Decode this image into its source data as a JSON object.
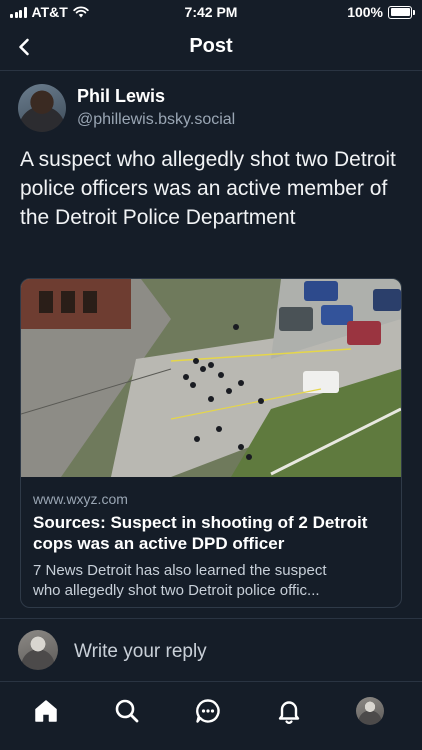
{
  "status_bar": {
    "carrier": "AT&T",
    "time": "7:42 PM",
    "battery": "100%"
  },
  "header": {
    "title": "Post",
    "back_icon": "chevron-left-icon"
  },
  "post": {
    "author_name": "Phil Lewis",
    "author_handle": "@phillewis.bsky.social",
    "text": "A suspect who allegedly shot two Detroit police officers was an active member of the Detroit Police Department"
  },
  "link_card": {
    "domain": "www.wxyz.com",
    "title": "Sources: Suspect in shooting of 2 Detroit cops was an active DPD officer",
    "description_line1": "7 News Detroit has also learned the suspect",
    "description_line2": "who allegedly shot two Detroit police offic..."
  },
  "reply": {
    "placeholder": "Write your reply"
  },
  "tab_bar": {
    "items": [
      "home-icon",
      "search-icon",
      "chat-icon",
      "bell-icon",
      "profile-avatar"
    ]
  },
  "colors": {
    "background": "#151d28",
    "accent": "#ffffff",
    "muted": "#9aa6b4",
    "border": "#2a3442"
  }
}
